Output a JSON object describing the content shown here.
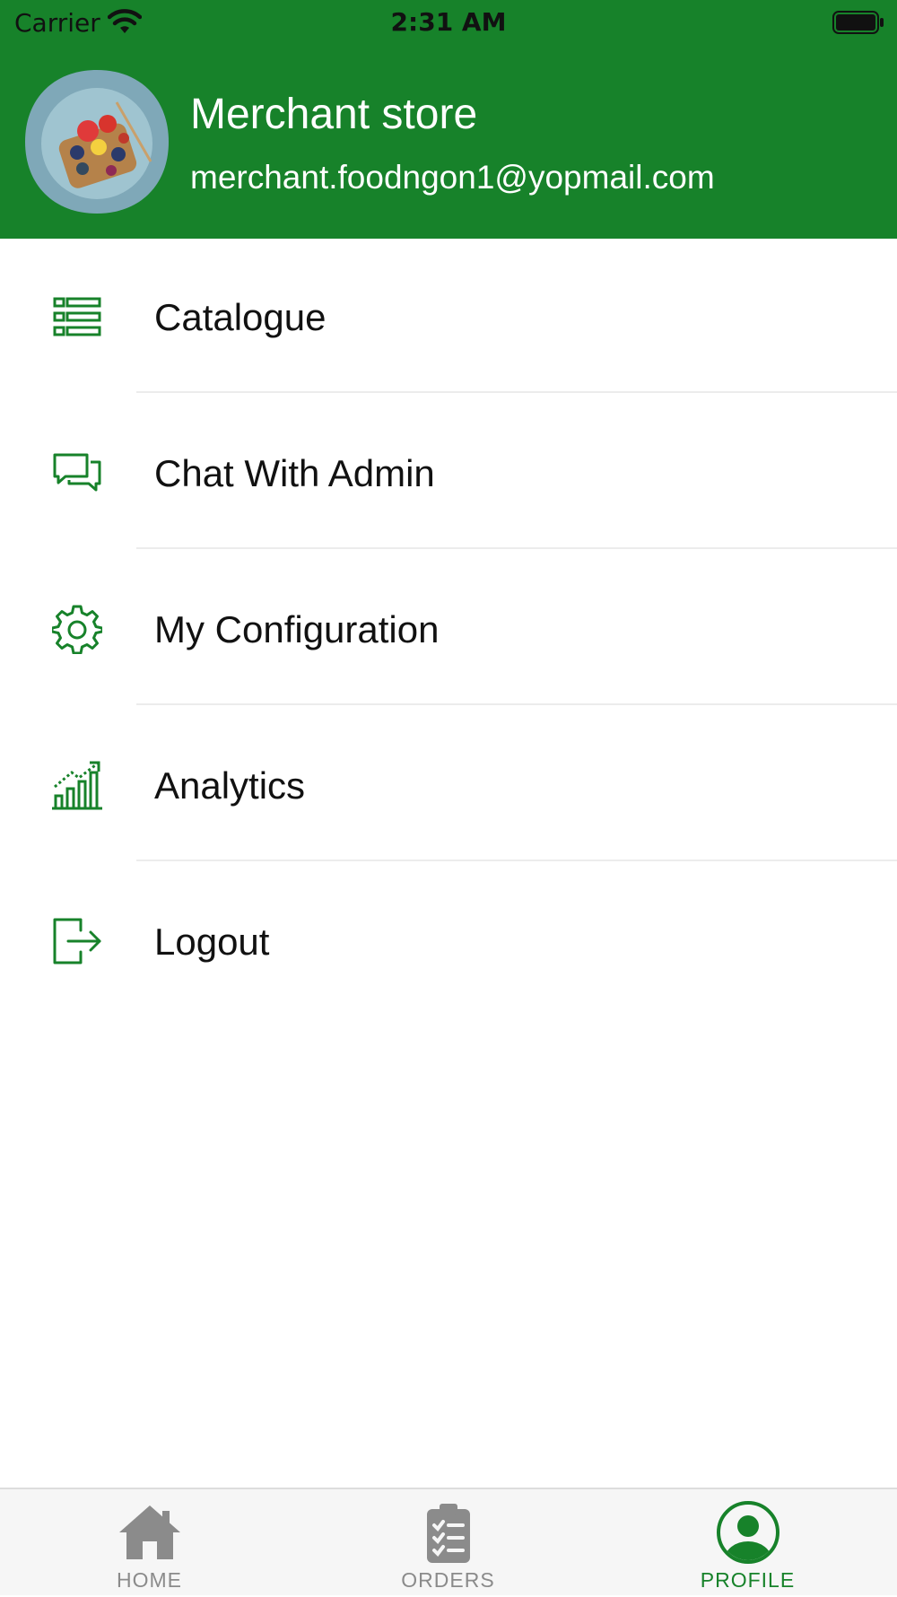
{
  "status_bar": {
    "carrier": "Carrier",
    "time": "2:31 AM"
  },
  "profile": {
    "store_name": "Merchant store",
    "email": "merchant.foodngon1@yopmail.com"
  },
  "menu": {
    "items": [
      {
        "label": "Catalogue",
        "icon": "list-icon"
      },
      {
        "label": "Chat With Admin",
        "icon": "chat-icon"
      },
      {
        "label": "My Configuration",
        "icon": "gear-icon"
      },
      {
        "label": "Analytics",
        "icon": "analytics-icon"
      },
      {
        "label": "Logout",
        "icon": "logout-icon"
      }
    ]
  },
  "tabbar": {
    "tabs": [
      {
        "label": "HOME",
        "icon": "home-icon",
        "active": false
      },
      {
        "label": "ORDERS",
        "icon": "clipboard-icon",
        "active": false
      },
      {
        "label": "PROFILE",
        "icon": "user-circle-icon",
        "active": true
      }
    ]
  },
  "colors": {
    "brand": "#17822a",
    "tab_inactive": "#8b8b8b",
    "divider": "#ececec"
  }
}
